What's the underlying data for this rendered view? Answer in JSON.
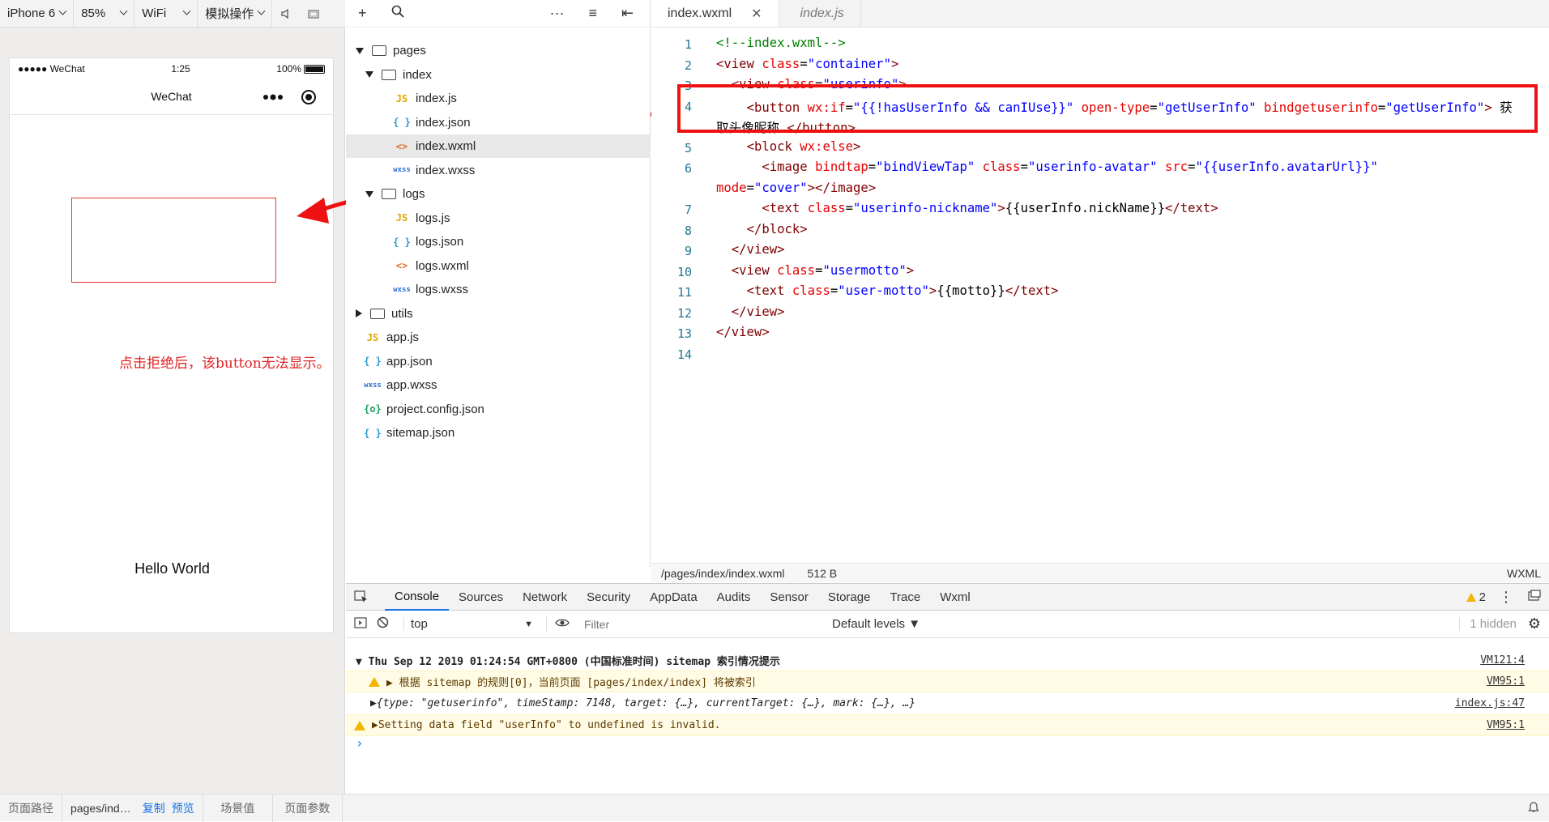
{
  "sim_toolbar": {
    "device": "iPhone 6",
    "zoom": "85%",
    "network": "WiFi",
    "simulate": "模拟操作"
  },
  "phone": {
    "carrier": "●●●●● WeChat",
    "time": "1:25",
    "battery": "100%",
    "nav_title": "WeChat",
    "annotation": "点击拒绝后，该button无法显示。",
    "hello": "Hello World"
  },
  "tree": [
    {
      "label": "pages",
      "type": "folder",
      "depth": 0,
      "state": "open"
    },
    {
      "label": "index",
      "type": "folder",
      "depth": 1,
      "state": "open"
    },
    {
      "label": "index.js",
      "type": "js",
      "depth": 2
    },
    {
      "label": "index.json",
      "type": "json",
      "depth": 2
    },
    {
      "label": "index.wxml",
      "type": "wxml",
      "depth": 2,
      "selected": true
    },
    {
      "label": "index.wxss",
      "type": "wxss",
      "depth": 2
    },
    {
      "label": "logs",
      "type": "folder",
      "depth": 1,
      "state": "open"
    },
    {
      "label": "logs.js",
      "type": "js",
      "depth": 2
    },
    {
      "label": "logs.json",
      "type": "json",
      "depth": 2
    },
    {
      "label": "logs.wxml",
      "type": "wxml",
      "depth": 2
    },
    {
      "label": "logs.wxss",
      "type": "wxss",
      "depth": 2
    },
    {
      "label": "utils",
      "type": "folder",
      "depth": 0,
      "state": "closed"
    },
    {
      "label": "app.js",
      "type": "js",
      "depth": 0
    },
    {
      "label": "app.json",
      "type": "json",
      "depth": 0
    },
    {
      "label": "app.wxss",
      "type": "wxss",
      "depth": 0
    },
    {
      "label": "project.config.json",
      "type": "config",
      "depth": 0
    },
    {
      "label": "sitemap.json",
      "type": "json",
      "depth": 0
    }
  ],
  "file_icons": {
    "js": "JS",
    "json": "{ }",
    "wxml": "<>",
    "wxss": "wxss",
    "config": "{o}"
  },
  "editor": {
    "tabs": [
      {
        "label": "index.wxml",
        "active": true
      },
      {
        "label": "index.js",
        "active": false
      }
    ],
    "line_numbers": [
      "1",
      "2",
      "3",
      "4",
      "5",
      "6",
      "7",
      "8",
      "9",
      "10",
      "11",
      "12",
      "13",
      "14"
    ],
    "status_path": "/pages/index/index.wxml",
    "status_size": "512 B",
    "status_lang": "WXML"
  },
  "code_lines": [
    [
      [
        "cm",
        "<!--index.wxml-->"
      ]
    ],
    [
      [
        "tg",
        "<view "
      ],
      [
        "at",
        "class"
      ],
      [
        "tx",
        "="
      ],
      [
        "av",
        "\"container\""
      ],
      [
        "tg",
        ">"
      ]
    ],
    [
      [
        "tx",
        "  "
      ],
      [
        "tg",
        "<view "
      ],
      [
        "at",
        "class"
      ],
      [
        "tx",
        "="
      ],
      [
        "av",
        "\"userinfo\""
      ],
      [
        "tg",
        ">"
      ]
    ],
    [
      [
        "tx",
        "    "
      ],
      [
        "tg",
        "<button "
      ],
      [
        "at",
        "wx:if"
      ],
      [
        "tx",
        "="
      ],
      [
        "av",
        "\"{{!hasUserInfo && canIUse}}\""
      ],
      [
        "tx",
        " "
      ],
      [
        "at",
        "open-type"
      ],
      [
        "tx",
        "="
      ],
      [
        "av",
        "\"getUserInfo\""
      ],
      [
        "tx",
        " "
      ],
      [
        "at",
        "bindgetuserinfo"
      ],
      [
        "tx",
        "="
      ],
      [
        "av",
        "\"getUserInfo\""
      ],
      [
        "tg",
        ">"
      ],
      [
        "tx",
        " 获"
      ]
    ],
    [
      [
        "tx",
        "取头像昵称 "
      ],
      [
        "tg",
        "</button>"
      ]
    ],
    [
      [
        "tx",
        "    "
      ],
      [
        "tg",
        "<block "
      ],
      [
        "at",
        "wx:else"
      ],
      [
        "tg",
        ">"
      ]
    ],
    [
      [
        "tx",
        "      "
      ],
      [
        "tg",
        "<image "
      ],
      [
        "at",
        "bindtap"
      ],
      [
        "tx",
        "="
      ],
      [
        "av",
        "\"bindViewTap\""
      ],
      [
        "tx",
        " "
      ],
      [
        "at",
        "class"
      ],
      [
        "tx",
        "="
      ],
      [
        "av",
        "\"userinfo-avatar\""
      ],
      [
        "tx",
        " "
      ],
      [
        "at",
        "src"
      ],
      [
        "tx",
        "="
      ],
      [
        "av",
        "\"{{userInfo.avatarUrl}}\""
      ]
    ],
    [
      [
        "at",
        "mode"
      ],
      [
        "tx",
        "="
      ],
      [
        "av",
        "\"cover\""
      ],
      [
        "tg",
        "></image>"
      ]
    ],
    [
      [
        "tx",
        "      "
      ],
      [
        "tg",
        "<text "
      ],
      [
        "at",
        "class"
      ],
      [
        "tx",
        "="
      ],
      [
        "av",
        "\"userinfo-nickname\""
      ],
      [
        "tg",
        ">"
      ],
      [
        "tx",
        "{{userInfo.nickName}}"
      ],
      [
        "tg",
        "</text>"
      ]
    ],
    [
      [
        "tx",
        "    "
      ],
      [
        "tg",
        "</block>"
      ]
    ],
    [
      [
        "tx",
        "  "
      ],
      [
        "tg",
        "</view>"
      ]
    ],
    [
      [
        "tx",
        "  "
      ],
      [
        "tg",
        "<view "
      ],
      [
        "at",
        "class"
      ],
      [
        "tx",
        "="
      ],
      [
        "av",
        "\"usermotto\""
      ],
      [
        "tg",
        ">"
      ]
    ],
    [
      [
        "tx",
        "    "
      ],
      [
        "tg",
        "<text "
      ],
      [
        "at",
        "class"
      ],
      [
        "tx",
        "="
      ],
      [
        "av",
        "\"user-motto\""
      ],
      [
        "tg",
        ">"
      ],
      [
        "tx",
        "{{motto}}"
      ],
      [
        "tg",
        "</text>"
      ]
    ],
    [
      [
        "tx",
        "  "
      ],
      [
        "tg",
        "</view>"
      ]
    ],
    [
      [
        "tg",
        "</view>"
      ]
    ],
    []
  ],
  "devtools": {
    "tabs": [
      "Console",
      "Sources",
      "Network",
      "Security",
      "AppData",
      "Audits",
      "Sensor",
      "Storage",
      "Trace",
      "Wxml"
    ],
    "warn_count": "2",
    "context": "top",
    "filter_placeholder": "Filter",
    "levels": "Default levels ▼",
    "hidden": "1 hidden",
    "messages": [
      {
        "text": "▼ Thu Sep 12 2019 01:24:54 GMT+0800 (中国标准时间) sitemap 索引情况提示",
        "src": "VM121:4",
        "kind": "group"
      },
      {
        "text": "▶ 根据 sitemap 的规则[0]，当前页面 [pages/index/index] 将被索引",
        "src": "VM95:1",
        "kind": "warn-inner"
      },
      {
        "text": "▶{type: \"getuserinfo\", timeStamp: 7148, target: {…}, currentTarget: {…}, mark: {…}, …}",
        "src": "index.js:47",
        "kind": "log"
      },
      {
        "text": "▶Setting data field \"userInfo\" to undefined is invalid.",
        "src": "VM95:1",
        "kind": "warn"
      }
    ],
    "prompt": "›"
  },
  "footer": {
    "path_label": "页面路径",
    "path_value": "pages/ind…",
    "copy": "复制",
    "preview": "预览",
    "scene": "场景值",
    "params": "页面参数"
  }
}
